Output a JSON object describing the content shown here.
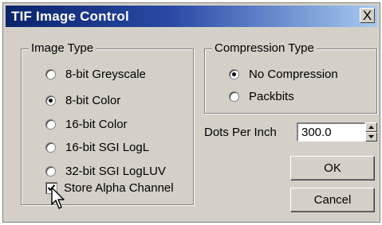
{
  "window": {
    "title": "TIF Image Control",
    "close_label": "X"
  },
  "image_type": {
    "title": "Image Type",
    "options": [
      {
        "label": "8-bit Greyscale",
        "checked": false
      },
      {
        "label": "8-bit Color",
        "checked": true
      },
      {
        "label": "16-bit Color",
        "checked": false
      },
      {
        "label": "16-bit SGI LogL",
        "checked": false
      },
      {
        "label": "32-bit SGI LogLUV",
        "checked": false
      }
    ],
    "store_alpha": {
      "label": "Store Alpha Channel",
      "checked": true
    }
  },
  "compression": {
    "title": "Compression Type",
    "options": [
      {
        "label": "No Compression",
        "checked": true
      },
      {
        "label": "Packbits",
        "checked": false
      }
    ]
  },
  "dpi": {
    "label": "Dots Per Inch",
    "value": "300.0"
  },
  "buttons": {
    "ok": "OK",
    "cancel": "Cancel"
  },
  "icons": {
    "close": "close-icon",
    "spinner_up": "spinner-up-icon",
    "spinner_down": "spinner-down-icon",
    "checkmark": "checkmark-icon",
    "cursor": "mouse-pointer-icon"
  }
}
